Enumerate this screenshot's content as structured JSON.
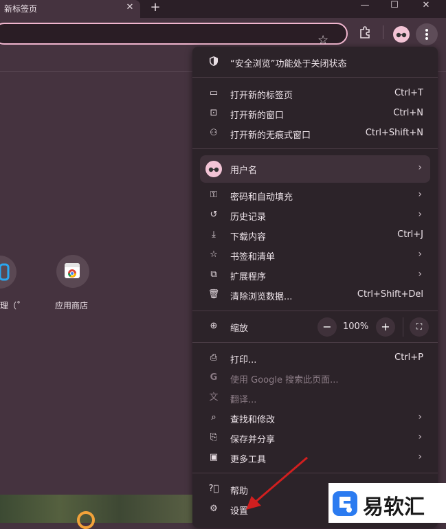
{
  "tab": {
    "title": "新标签页"
  },
  "window": {
    "minimize": "—",
    "maximize": "☐",
    "close": "✕",
    "new_tab": "+",
    "tab_close": "✕"
  },
  "shortcuts": [
    {
      "label": "理（˚"
    },
    {
      "label": "应用商店"
    }
  ],
  "menu": {
    "safe_browsing": "“安全浏览”功能处于关闭状态",
    "items_group1": [
      {
        "label": "打开新的标签页",
        "shortcut": "Ctrl+T",
        "icon": "new-tab-icon"
      },
      {
        "label": "打开新的窗口",
        "shortcut": "Ctrl+N",
        "icon": "new-window-icon"
      },
      {
        "label": "打开新的无痕式窗口",
        "shortcut": "Ctrl+Shift+N",
        "icon": "incognito-icon"
      }
    ],
    "profile": {
      "name": "用户名"
    },
    "items_group2": [
      {
        "label": "密码和自动填充",
        "shortcut": "",
        "icon": "key-icon"
      },
      {
        "label": "历史记录",
        "shortcut": "",
        "icon": "history-icon"
      },
      {
        "label": "下载内容",
        "shortcut": "Ctrl+J",
        "icon": "download-icon"
      },
      {
        "label": "书签和清单",
        "shortcut": "",
        "icon": "bookmark-star-icon"
      },
      {
        "label": "扩展程序",
        "shortcut": "",
        "icon": "extension-icon"
      },
      {
        "label": "清除浏览数据...",
        "shortcut": "Ctrl+Shift+Del",
        "icon": "trash-icon"
      }
    ],
    "zoom": {
      "label": "缩放",
      "value": "100%",
      "minus": "−",
      "plus": "+"
    },
    "items_group3": [
      {
        "label": "打印...",
        "shortcut": "Ctrl+P",
        "icon": "print-icon"
      },
      {
        "label": "使用 Google 搜索此页面...",
        "shortcut": "",
        "icon": "google-icon"
      },
      {
        "label": "翻译...",
        "shortcut": "",
        "icon": "translate-icon"
      },
      {
        "label": "查找和修改",
        "shortcut": "",
        "icon": "find-icon"
      },
      {
        "label": "保存并分享",
        "shortcut": "",
        "icon": "save-share-icon"
      },
      {
        "label": "更多工具",
        "shortcut": "",
        "icon": "toolbox-icon"
      }
    ],
    "items_group4": [
      {
        "label": "帮助",
        "icon": "help-icon"
      },
      {
        "label": "设置",
        "icon": "settings-gear-icon"
      }
    ]
  },
  "watermark": {
    "text": "易软汇"
  },
  "colors": {
    "accent": "#f1b6cf",
    "menu_bg": "#2c2329",
    "page_bg": "#45333f",
    "arrow": "#d11f1f"
  }
}
